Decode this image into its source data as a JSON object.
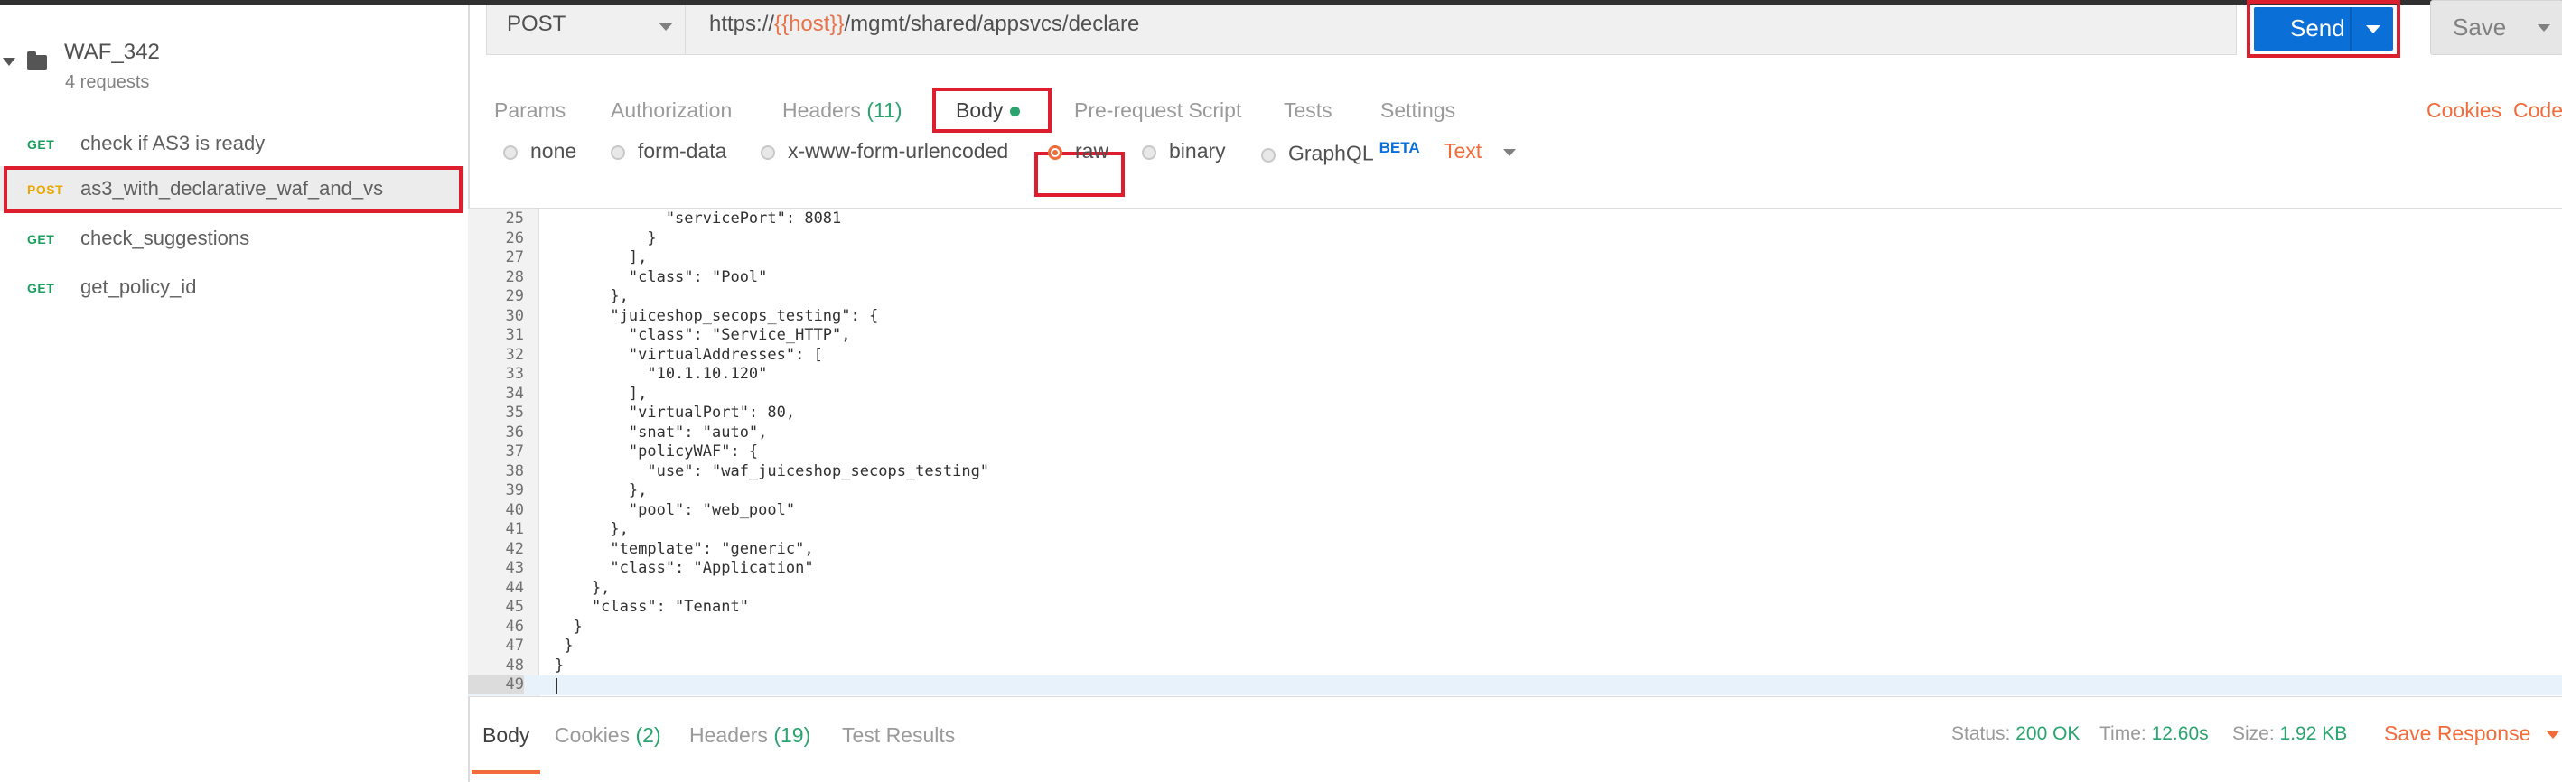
{
  "sidebar": {
    "collection": {
      "name": "WAF_342",
      "count": "4 requests"
    },
    "requests": [
      {
        "method": "GET",
        "name": "check if AS3 is ready"
      },
      {
        "method": "POST",
        "name": "as3_with_declarative_waf_and_vs"
      },
      {
        "method": "GET",
        "name": "check_suggestions"
      },
      {
        "method": "GET",
        "name": "get_policy_id"
      }
    ]
  },
  "request": {
    "method": "POST",
    "url_prefix": "https://",
    "url_var": "{{host}}",
    "url_suffix": "/mgmt/shared/appsvcs/declare",
    "send_label": "Send",
    "save_label": "Save"
  },
  "tabs": {
    "params": "Params",
    "authorization": "Authorization",
    "headers": "Headers",
    "headers_count": "(11)",
    "body": "Body",
    "prerequest": "Pre-request Script",
    "tests": "Tests",
    "settings": "Settings",
    "cookies": "Cookies",
    "code": "Code"
  },
  "body_types": {
    "none": "none",
    "form_data": "form-data",
    "urlencoded": "x-www-form-urlencoded",
    "raw": "raw",
    "binary": "binary",
    "graphql": "GraphQL",
    "beta": "BETA",
    "text_type": "Text"
  },
  "editor": {
    "lines": [
      {
        "n": "25",
        "code": "            \"servicePort\": 8081"
      },
      {
        "n": "26",
        "code": "          }"
      },
      {
        "n": "27",
        "code": "        ],"
      },
      {
        "n": "28",
        "code": "        \"class\": \"Pool\""
      },
      {
        "n": "29",
        "code": "      },"
      },
      {
        "n": "30",
        "code": "      \"juiceshop_secops_testing\": {"
      },
      {
        "n": "31",
        "code": "        \"class\": \"Service_HTTP\","
      },
      {
        "n": "32",
        "code": "        \"virtualAddresses\": ["
      },
      {
        "n": "33",
        "code": "          \"10.1.10.120\""
      },
      {
        "n": "34",
        "code": "        ],"
      },
      {
        "n": "35",
        "code": "        \"virtualPort\": 80,"
      },
      {
        "n": "36",
        "code": "        \"snat\": \"auto\","
      },
      {
        "n": "37",
        "code": "        \"policyWAF\": {"
      },
      {
        "n": "38",
        "code": "          \"use\": \"waf_juiceshop_secops_testing\""
      },
      {
        "n": "39",
        "code": "        },"
      },
      {
        "n": "40",
        "code": "        \"pool\": \"web_pool\""
      },
      {
        "n": "41",
        "code": "      },"
      },
      {
        "n": "42",
        "code": "      \"template\": \"generic\","
      },
      {
        "n": "43",
        "code": "      \"class\": \"Application\""
      },
      {
        "n": "44",
        "code": "    },"
      },
      {
        "n": "45",
        "code": "    \"class\": \"Tenant\""
      },
      {
        "n": "46",
        "code": "  }"
      },
      {
        "n": "47",
        "code": " }"
      },
      {
        "n": "48",
        "code": "}"
      },
      {
        "n": "49",
        "code": ""
      }
    ]
  },
  "response": {
    "body": "Body",
    "cookies": "Cookies",
    "cookies_count": "(2)",
    "headers": "Headers",
    "headers_count": "(19)",
    "test_results": "Test Results",
    "status_label": "Status:",
    "status_value": "200 OK",
    "time_label": "Time:",
    "time_value": "12.60s",
    "size_label": "Size:",
    "size_value": "1.92 KB",
    "save_response": "Save Response"
  }
}
